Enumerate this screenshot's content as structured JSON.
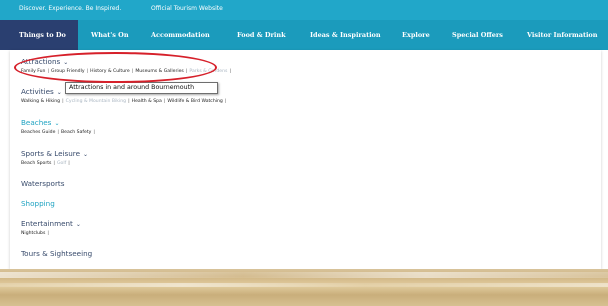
{
  "topbar": {
    "tagline": "Discover. Experience. Be Inspired.",
    "official": "Official Tourism Website"
  },
  "nav": {
    "items": [
      {
        "label": "Things to Do"
      },
      {
        "label": "What's On"
      },
      {
        "label": "Accommodation"
      },
      {
        "label": "Food & Drink"
      },
      {
        "label": "Ideas & Inspiration"
      },
      {
        "label": "Explore"
      },
      {
        "label": "Special Offers"
      },
      {
        "label": "Visitor Information"
      }
    ]
  },
  "menu": {
    "attractions": {
      "title": "Attractions",
      "links": [
        "Family Fun",
        "Group Friendly",
        "History & Culture",
        "Museums & Galleries",
        "Parks & Gardens"
      ]
    },
    "activities": {
      "title": "Activities",
      "links": [
        "Walking & Hiking",
        "Cycling & Mountain Biking",
        "Health & Spa",
        "Wildlife & Bird Watching"
      ]
    },
    "beaches": {
      "title": "Beaches",
      "links": [
        "Beaches Guide",
        "Beach Safety"
      ]
    },
    "sports": {
      "title": "Sports & Leisure",
      "links": [
        "Beach Sports",
        "Golf"
      ]
    },
    "watersports": {
      "title": "Watersports"
    },
    "shopping": {
      "title": "Shopping"
    },
    "entertainment": {
      "title": "Entertainment",
      "links": [
        "Nightclubs"
      ]
    },
    "tours": {
      "title": "Tours & Sightseeing"
    }
  },
  "tooltip": {
    "text": "Attractions in and around Bournemouth"
  },
  "colors": {
    "topbar": "#21a7c9",
    "navbar": "#1b9bbc",
    "active_tab": "#2a3f70",
    "category_text": "#374a6b",
    "teal_text": "#1fa3c2",
    "highlight_circle": "#d6202a"
  },
  "icons": {
    "chevron": "chevron-down-icon"
  }
}
